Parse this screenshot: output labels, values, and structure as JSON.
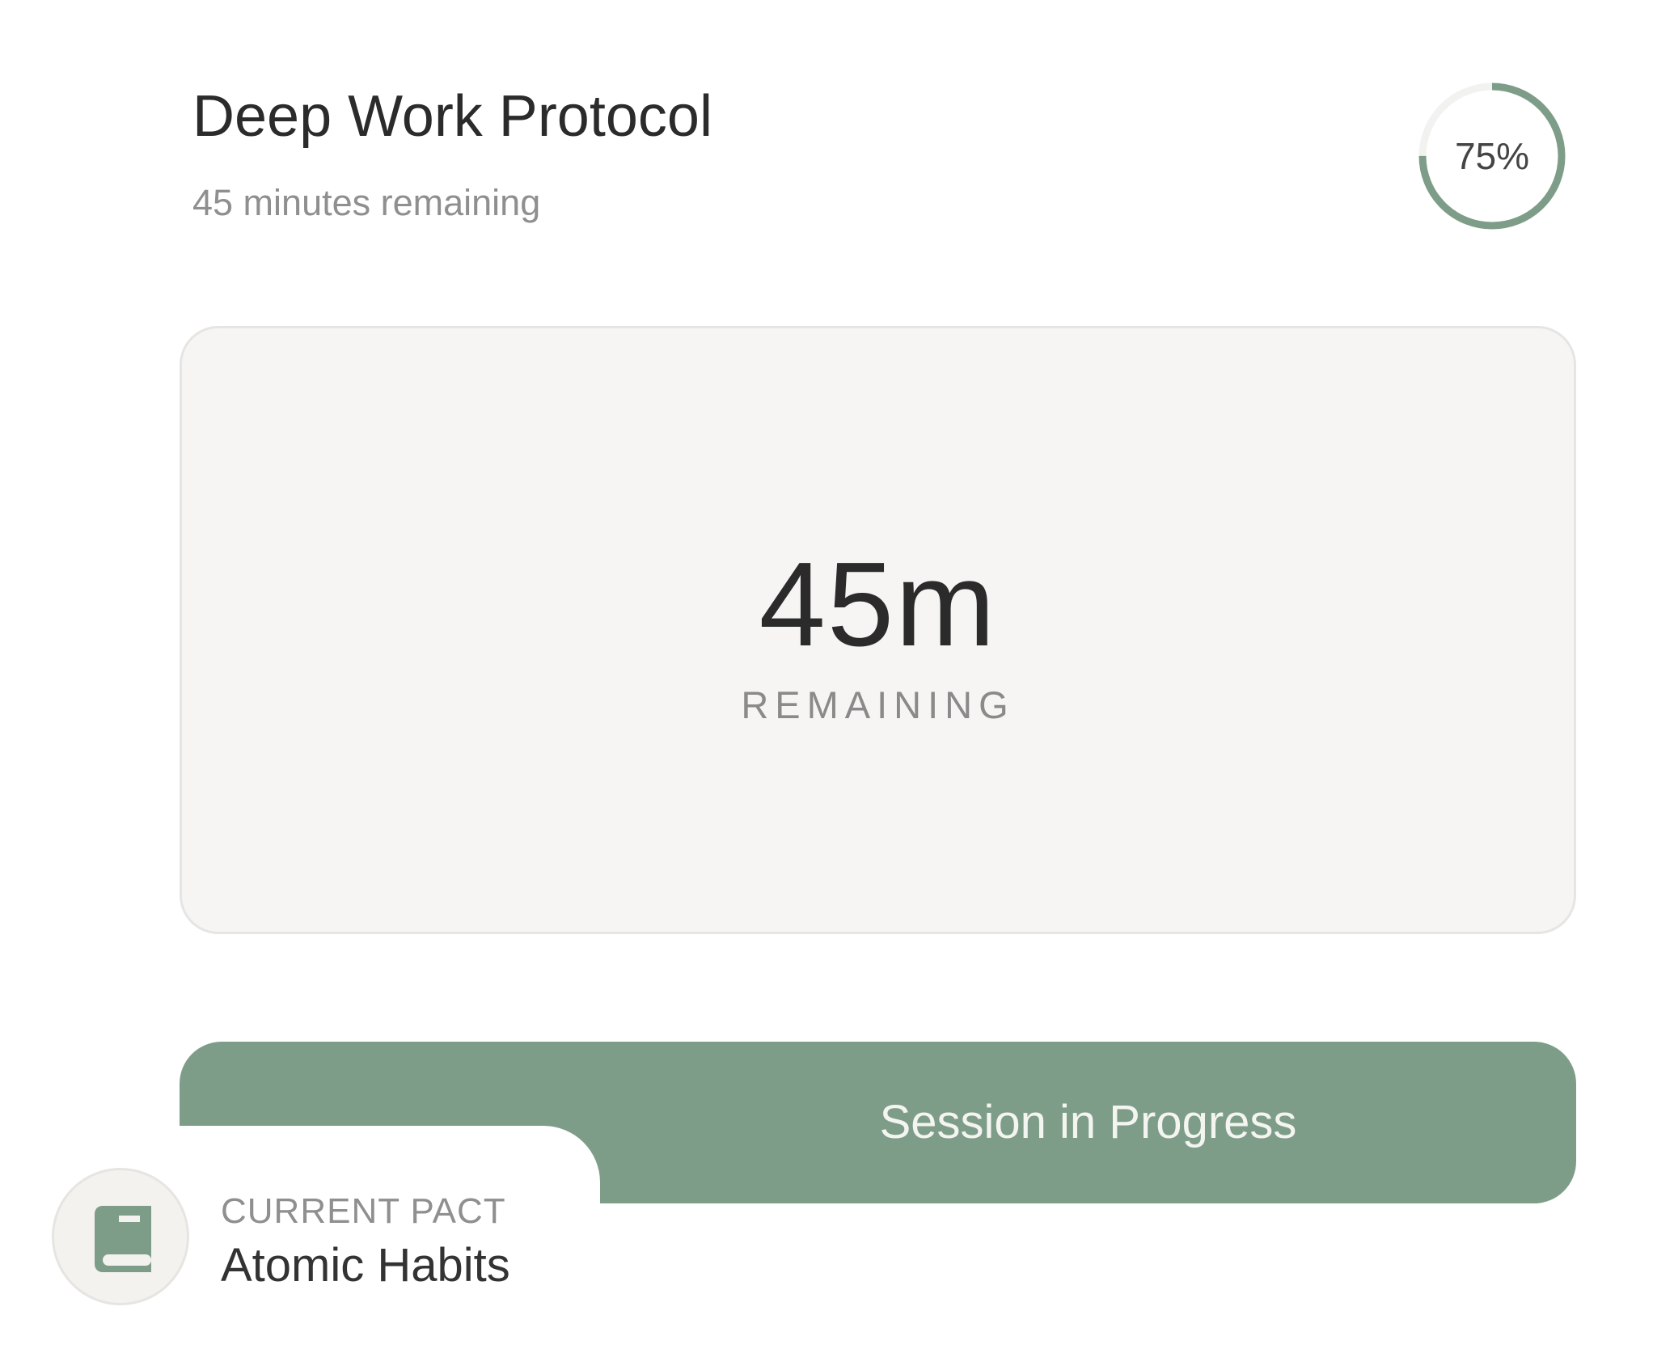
{
  "header": {
    "title": "Deep Work Protocol",
    "subtitle": "45 minutes remaining"
  },
  "progress": {
    "value": 0.75,
    "label": "75%"
  },
  "timer": {
    "value": "45m",
    "label": "REMAINING"
  },
  "session": {
    "status_label": "Session in Progress"
  },
  "pact": {
    "caption": "CURRENT PACT",
    "name": "Atomic Habits",
    "icon": "book-icon"
  },
  "colors": {
    "accent": "#7e9d89",
    "card_background": "#f6f5f3",
    "text_primary": "#2b2b2b",
    "text_secondary": "#8f8f8f"
  }
}
